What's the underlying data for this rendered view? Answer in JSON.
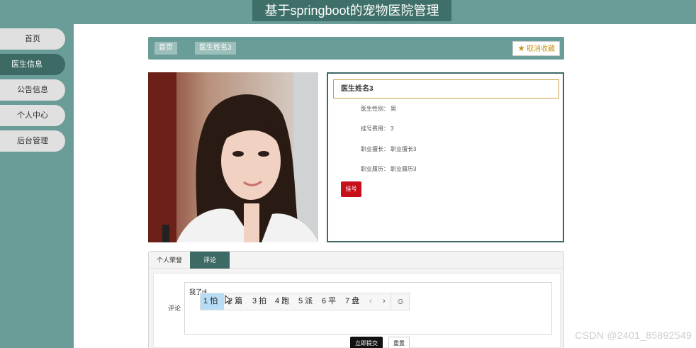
{
  "app": {
    "title": "基于springboot的宠物医院管理"
  },
  "sidebar": {
    "items": [
      {
        "label": "首页",
        "active": false
      },
      {
        "label": "医生信息",
        "active": true
      },
      {
        "label": "公告信息",
        "active": false
      },
      {
        "label": "个人中心",
        "active": false
      },
      {
        "label": "后台管理",
        "active": false
      }
    ]
  },
  "breadcrumb": {
    "home": "首页",
    "current": "医生姓名3"
  },
  "favorite_button": {
    "icon": "star-icon",
    "label": "取消收藏"
  },
  "doctor": {
    "name": "医生姓名3",
    "fields": [
      {
        "label": "医生性别：",
        "value": "男"
      },
      {
        "label": "挂号费用：",
        "value": "3"
      },
      {
        "label": "职业擅长：",
        "value": "职业擅长3"
      },
      {
        "label": "职业履历：",
        "value": "职业履历3"
      }
    ],
    "register_label": "挂号"
  },
  "tabs": [
    {
      "label": "个人荣誉",
      "active": false
    },
    {
      "label": "评论",
      "active": true
    }
  ],
  "comment": {
    "label": "评论",
    "typed_text": "我了p"
  },
  "ime": {
    "candidates": [
      "1 怕",
      "2 篇",
      "3 拍",
      "4 跑",
      "5 派",
      "6 平",
      "7 盘"
    ],
    "prev": "‹",
    "next": "›",
    "emoji": "☺"
  },
  "buttons": {
    "submit": "立即提交",
    "reset": "重置"
  },
  "watermark": "CSDN @2401_85892549",
  "colors": {
    "primary": "#6a9d97",
    "dark": "#3e6a65",
    "accent_red": "#c8101c",
    "gold": "#c9a24a"
  }
}
